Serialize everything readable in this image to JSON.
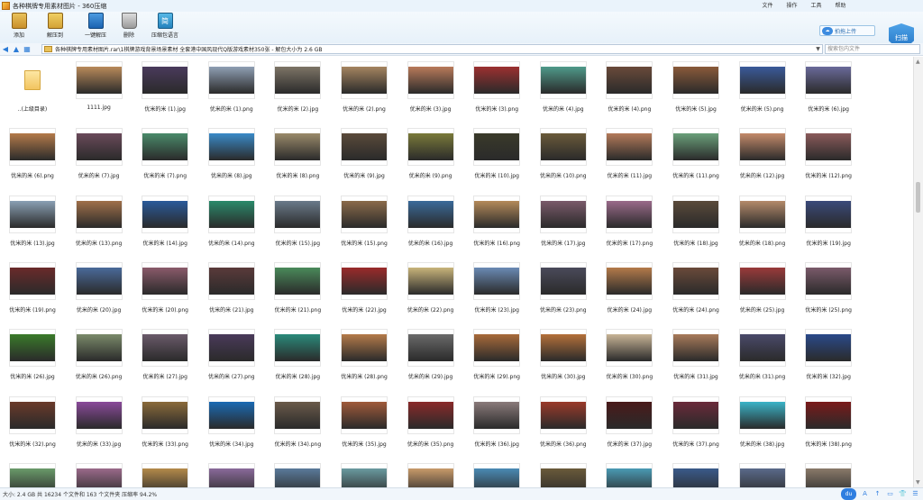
{
  "window": {
    "title": "各种棋牌专用素材图片 - 360压缩",
    "menu": [
      "文件",
      "操作",
      "工具",
      "帮助"
    ]
  },
  "toolbar": {
    "items": [
      {
        "key": "add",
        "label": "添加",
        "icon": "add-archive-icon"
      },
      {
        "key": "extract",
        "label": "解压到",
        "icon": "extract-folder-icon"
      },
      {
        "key": "oneclick",
        "label": "一键解压",
        "icon": "one-click-extract-icon"
      },
      {
        "key": "delete",
        "label": "删除",
        "icon": "trash-icon"
      },
      {
        "key": "tools",
        "label": "压缩包语言",
        "icon": "archive-tools-icon"
      }
    ],
    "tools_glyph": "简",
    "upload_label": "拍拖上传",
    "upload_glyph": "☁",
    "shield_label": "扫描"
  },
  "address": {
    "path": "各种棋牌专用素材图片.rar\\1棋牌游戏背景场景素材 全套港中国风现代Q版游戏素材350张 - 解包大小为 2.6 GB",
    "search_placeholder": "搜索包内文件",
    "back_glyph": "◀",
    "up_glyph": "▲",
    "view_glyph": "▦"
  },
  "files": [
    {
      "name": "..(上级目录)",
      "type": "folder"
    },
    {
      "name": "1111.jpg",
      "color": "#b98a5a"
    },
    {
      "name": "优米的米 (1).jpg",
      "color": "#4a3a5c"
    },
    {
      "name": "优米的米 (1).png",
      "color": "#8f9fb4"
    },
    {
      "name": "优米的米 (2).jpg",
      "color": "#7d7466"
    },
    {
      "name": "优米的米 (2).png",
      "color": "#a58460"
    },
    {
      "name": "优米的米 (3).jpg",
      "color": "#b97a5a"
    },
    {
      "name": "优米的米 (3).png",
      "color": "#9c3030"
    },
    {
      "name": "优米的米 (4).jpg",
      "color": "#4f9a8a"
    },
    {
      "name": "优米的米 (4).png",
      "color": "#6a4a3a"
    },
    {
      "name": "优米的米 (5).jpg",
      "color": "#8a5a3a"
    },
    {
      "name": "优米的米 (5).png",
      "color": "#3a5a9a"
    },
    {
      "name": "优米的米 (6).jpg",
      "color": "#6a6a9a"
    },
    {
      "name": "优米的米 (6).png",
      "color": "#b47a4a"
    },
    {
      "name": "优米的米 (7).jpg",
      "color": "#6a4a5a"
    },
    {
      "name": "优米的米 (7).png",
      "color": "#4a8a6a"
    },
    {
      "name": "优米的米 (8).jpg",
      "color": "#3a8ac8"
    },
    {
      "name": "优米的米 (8).png",
      "color": "#9a8a6a"
    },
    {
      "name": "优米的米 (9).jpg",
      "color": "#5a4a3a"
    },
    {
      "name": "优米的米 (9).png",
      "color": "#7a7a3a"
    },
    {
      "name": "优米的米 (10).jpg",
      "color": "#3a3a2a"
    },
    {
      "name": "优米的米 (10).png",
      "color": "#6a5a3a"
    },
    {
      "name": "优米的米 (11).jpg",
      "color": "#b47a5a"
    },
    {
      "name": "优米的米 (11).png",
      "color": "#6aa07a"
    },
    {
      "name": "优米的米 (12).jpg",
      "color": "#c48a6a"
    },
    {
      "name": "优米的米 (12).png",
      "color": "#8a5a5a"
    },
    {
      "name": "优米的米 (13).jpg",
      "color": "#8aa0b4"
    },
    {
      "name": "优米的米 (13).png",
      "color": "#a0704a"
    },
    {
      "name": "优米的米 (14).jpg",
      "color": "#2a5a9a"
    },
    {
      "name": "优米的米 (14).png",
      "color": "#2a8a6a"
    },
    {
      "name": "优米的米 (15).jpg",
      "color": "#6a7a8a"
    },
    {
      "name": "优米的米 (15).png",
      "color": "#8a6a4a"
    },
    {
      "name": "优米的米 (16).jpg",
      "color": "#3a6a9a"
    },
    {
      "name": "优米的米 (16).png",
      "color": "#b48a5a"
    },
    {
      "name": "优米的米 (17).jpg",
      "color": "#7a5a6a"
    },
    {
      "name": "优米的米 (17).png",
      "color": "#9a6a8a"
    },
    {
      "name": "优米的米 (18).jpg",
      "color": "#5a4a3a"
    },
    {
      "name": "优米的米 (18).png",
      "color": "#b48a6a"
    },
    {
      "name": "优米的米 (19).jpg",
      "color": "#3a4a7a"
    },
    {
      "name": "优米的米 (19).png",
      "color": "#6a2a2a"
    },
    {
      "name": "优米的米 (20).jpg",
      "color": "#4a6a9a"
    },
    {
      "name": "优米的米 (20).png",
      "color": "#8a5a6a"
    },
    {
      "name": "优米的米 (21).jpg",
      "color": "#5a3a3a"
    },
    {
      "name": "优米的米 (21).png",
      "color": "#4a8a5a"
    },
    {
      "name": "优米的米 (22).jpg",
      "color": "#9a2a2a"
    },
    {
      "name": "优米的米 (22).png",
      "color": "#c8b47a"
    },
    {
      "name": "优米的米 (23).jpg",
      "color": "#6a8ab4"
    },
    {
      "name": "优米的米 (23).png",
      "color": "#4a4a5a"
    },
    {
      "name": "优米的米 (24).jpg",
      "color": "#b47a4a"
    },
    {
      "name": "优米的米 (24).png",
      "color": "#6a4a3a"
    },
    {
      "name": "优米的米 (25).jpg",
      "color": "#9a3a3a"
    },
    {
      "name": "优米的米 (25).png",
      "color": "#7a5a6a"
    },
    {
      "name": "优米的米 (26).jpg",
      "color": "#3a7a2a"
    },
    {
      "name": "优米的米 (26).png",
      "color": "#7a8a6a"
    },
    {
      "name": "优米的米 (27).jpg",
      "color": "#6a5a6a"
    },
    {
      "name": "优米的米 (27).png",
      "color": "#4a3a5a"
    },
    {
      "name": "优米的米 (28).jpg",
      "color": "#2a8a7a"
    },
    {
      "name": "优米的米 (28).png",
      "color": "#b47a4a"
    },
    {
      "name": "优米的米 (29).jpg",
      "color": "#6a6a6a"
    },
    {
      "name": "优米的米 (29).png",
      "color": "#a86a3a"
    },
    {
      "name": "优米的米 (30).jpg",
      "color": "#b4703a"
    },
    {
      "name": "优米的米 (30).png",
      "color": "#c8b496"
    },
    {
      "name": "优米的米 (31).jpg",
      "color": "#a87a5a"
    },
    {
      "name": "优米的米 (31).png",
      "color": "#4a4a6a"
    },
    {
      "name": "优米的米 (32).jpg",
      "color": "#2a4a8a"
    },
    {
      "name": "优米的米 (32).png",
      "color": "#6a3a2a"
    },
    {
      "name": "优米的米 (33).jpg",
      "color": "#8a4a9a"
    },
    {
      "name": "优米的米 (33).png",
      "color": "#8a6a3a"
    },
    {
      "name": "优米的米 (34).jpg",
      "color": "#1a6ab4"
    },
    {
      "name": "优米的米 (34).png",
      "color": "#6a5a4a"
    },
    {
      "name": "优米的米 (35).jpg",
      "color": "#a05a3a"
    },
    {
      "name": "优米的米 (35).png",
      "color": "#8a2a2a"
    },
    {
      "name": "优米的米 (36).jpg",
      "color": "#8a7a7a"
    },
    {
      "name": "优米的米 (36).png",
      "color": "#9a3a2a"
    },
    {
      "name": "优米的米 (37).jpg",
      "color": "#4a1a1a"
    },
    {
      "name": "优米的米 (37).png",
      "color": "#6a2a3a"
    },
    {
      "name": "优米的米 (38).jpg",
      "color": "#3ab4c8"
    },
    {
      "name": "优米的米 (38).png",
      "color": "#7a1a1a"
    },
    {
      "name": "",
      "color": "#6a9a6a"
    },
    {
      "name": "",
      "color": "#9a6a8a"
    },
    {
      "name": "",
      "color": "#b48a4a"
    },
    {
      "name": "",
      "color": "#8a6a9a"
    },
    {
      "name": "",
      "color": "#5a7a9a"
    },
    {
      "name": "",
      "color": "#6a9aa0"
    },
    {
      "name": "",
      "color": "#c89a6a"
    },
    {
      "name": "",
      "color": "#4a8ab4"
    },
    {
      "name": "",
      "color": "#6a5a3a"
    },
    {
      "name": "",
      "color": "#4a9ab4"
    },
    {
      "name": "",
      "color": "#3a5a8a"
    },
    {
      "name": "",
      "color": "#5a6a8a"
    },
    {
      "name": "",
      "color": "#8a7a6a"
    }
  ],
  "status": {
    "text": "大小: 2.4 GB 共 16234 个文件和 163 个文件夹 压缩率 94.2%",
    "du_label": "du",
    "tray_glyphs": [
      "A",
      "↑",
      "▭",
      "👕",
      "☰"
    ]
  },
  "scrollbar": {
    "up_glyph": "▲",
    "down_glyph": "▼"
  }
}
